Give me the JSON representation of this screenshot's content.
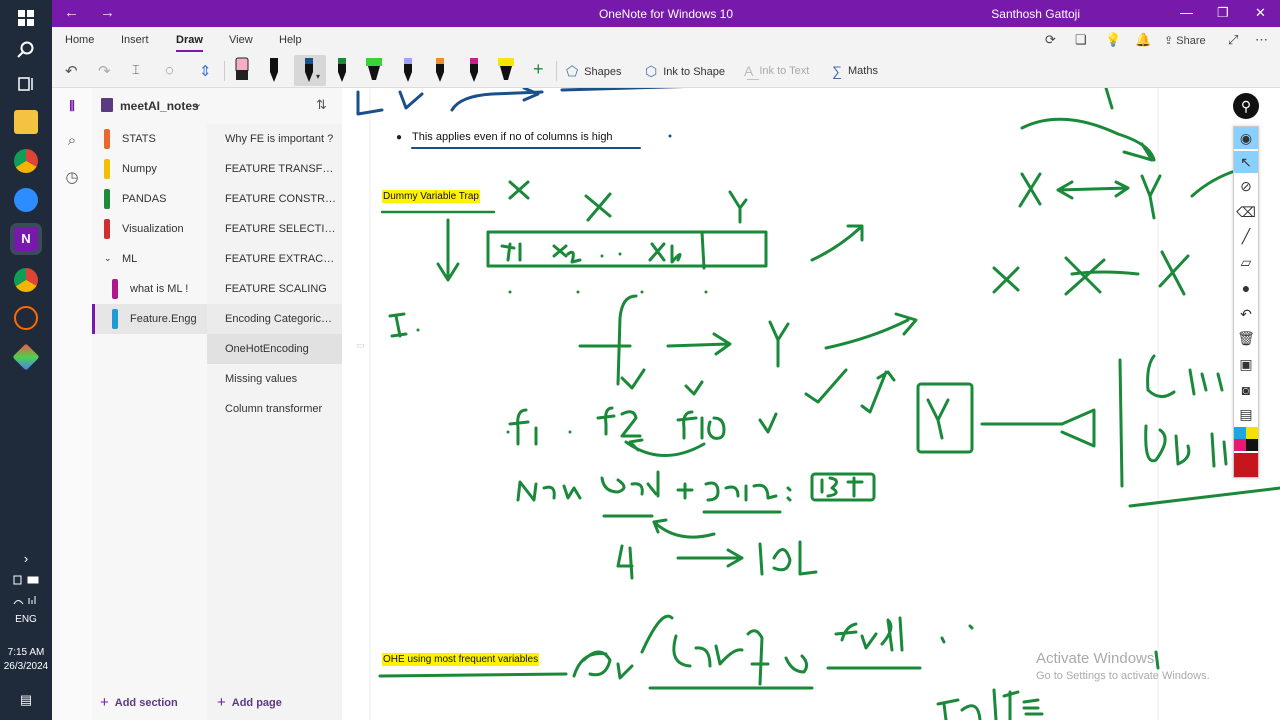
{
  "window": {
    "title": "OneNote for Windows 10",
    "user": "Santhosh Gattoji"
  },
  "menu": [
    "Home",
    "Insert",
    "Draw",
    "View",
    "Help"
  ],
  "menu_right": {
    "share": "Share"
  },
  "ribbon": {
    "shapes": "Shapes",
    "ink_to_shape": "Ink to Shape",
    "ink_to_text": "Ink to Text",
    "maths": "Maths"
  },
  "notebook": {
    "name": "meetAI_notes"
  },
  "sections": [
    {
      "label": "STATS",
      "color": "#e8692b"
    },
    {
      "label": "Numpy",
      "color": "#f2c000"
    },
    {
      "label": "PANDAS",
      "color": "#1e8a3c"
    },
    {
      "label": "Visualization",
      "color": "#d02e2e"
    },
    {
      "label": "ML",
      "color": ""
    },
    {
      "label": "what is ML !",
      "color": "#b0178f"
    },
    {
      "label": "Feature.Engg",
      "color": "#1e9ad6"
    }
  ],
  "pages": [
    "Why FE is important ?",
    "FEATURE TRANSFORMATION",
    "FEATURE CONSTRUCTION",
    "FEATURE SELECTION",
    "FEATURE EXTRACTION",
    "FEATURE SCALING",
    "Encoding Categorical data",
    "OneHotEncoding",
    "Missing values",
    "Column transformer"
  ],
  "footer": {
    "add_section": "Add section",
    "add_page": "Add page"
  },
  "note": {
    "bullet": "This applies even if no of columns is high",
    "heading1": "Dummy Variable Trap",
    "heading2": "OHE using most frequent variables"
  },
  "taskbar": {
    "lang": "ENG",
    "time": "7:15 AM",
    "date": "26/3/2024"
  },
  "watermark": {
    "line1": "Activate Windows",
    "line2": "Go to Settings to activate Windows."
  },
  "colors": {
    "accent": "#7719aa",
    "ink": "#1a8a3a",
    "ink_blue": "#1a4f8a",
    "highlight": "#fff200"
  }
}
